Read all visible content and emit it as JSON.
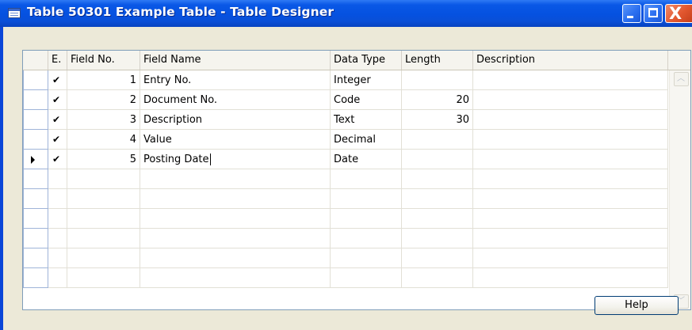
{
  "window": {
    "title": "Table 50301 Example Table - Table Designer",
    "icon": "table-icon",
    "controls": [
      "minimize",
      "maximize",
      "close"
    ],
    "close_glyph": "X"
  },
  "columns": [
    {
      "key": "enabled",
      "label": "E."
    },
    {
      "key": "field_no",
      "label": "Field No."
    },
    {
      "key": "field_name",
      "label": "Field Name"
    },
    {
      "key": "data_type",
      "label": "Data Type"
    },
    {
      "key": "length",
      "label": "Length"
    },
    {
      "key": "description",
      "label": "Description"
    }
  ],
  "rows": [
    {
      "enabled": "✔",
      "field_no": "1",
      "field_name": "Entry No.",
      "data_type": "Integer",
      "length": "",
      "description": ""
    },
    {
      "enabled": "✔",
      "field_no": "2",
      "field_name": "Document No.",
      "data_type": "Code",
      "length": "20",
      "description": ""
    },
    {
      "enabled": "✔",
      "field_no": "3",
      "field_name": "Description",
      "data_type": "Text",
      "length": "30",
      "description": ""
    },
    {
      "enabled": "✔",
      "field_no": "4",
      "field_name": "Value",
      "data_type": "Decimal",
      "length": "",
      "description": ""
    },
    {
      "enabled": "✔",
      "field_no": "5",
      "field_name": "Posting Date",
      "data_type": "Date",
      "length": "",
      "description": "",
      "current": true
    }
  ],
  "empty_row_count": 6,
  "buttons": {
    "help_label": "Help"
  },
  "colors": {
    "titlebar": "#0a58e6",
    "client_bg": "#ece9d8",
    "close_button": "#e2572f"
  }
}
